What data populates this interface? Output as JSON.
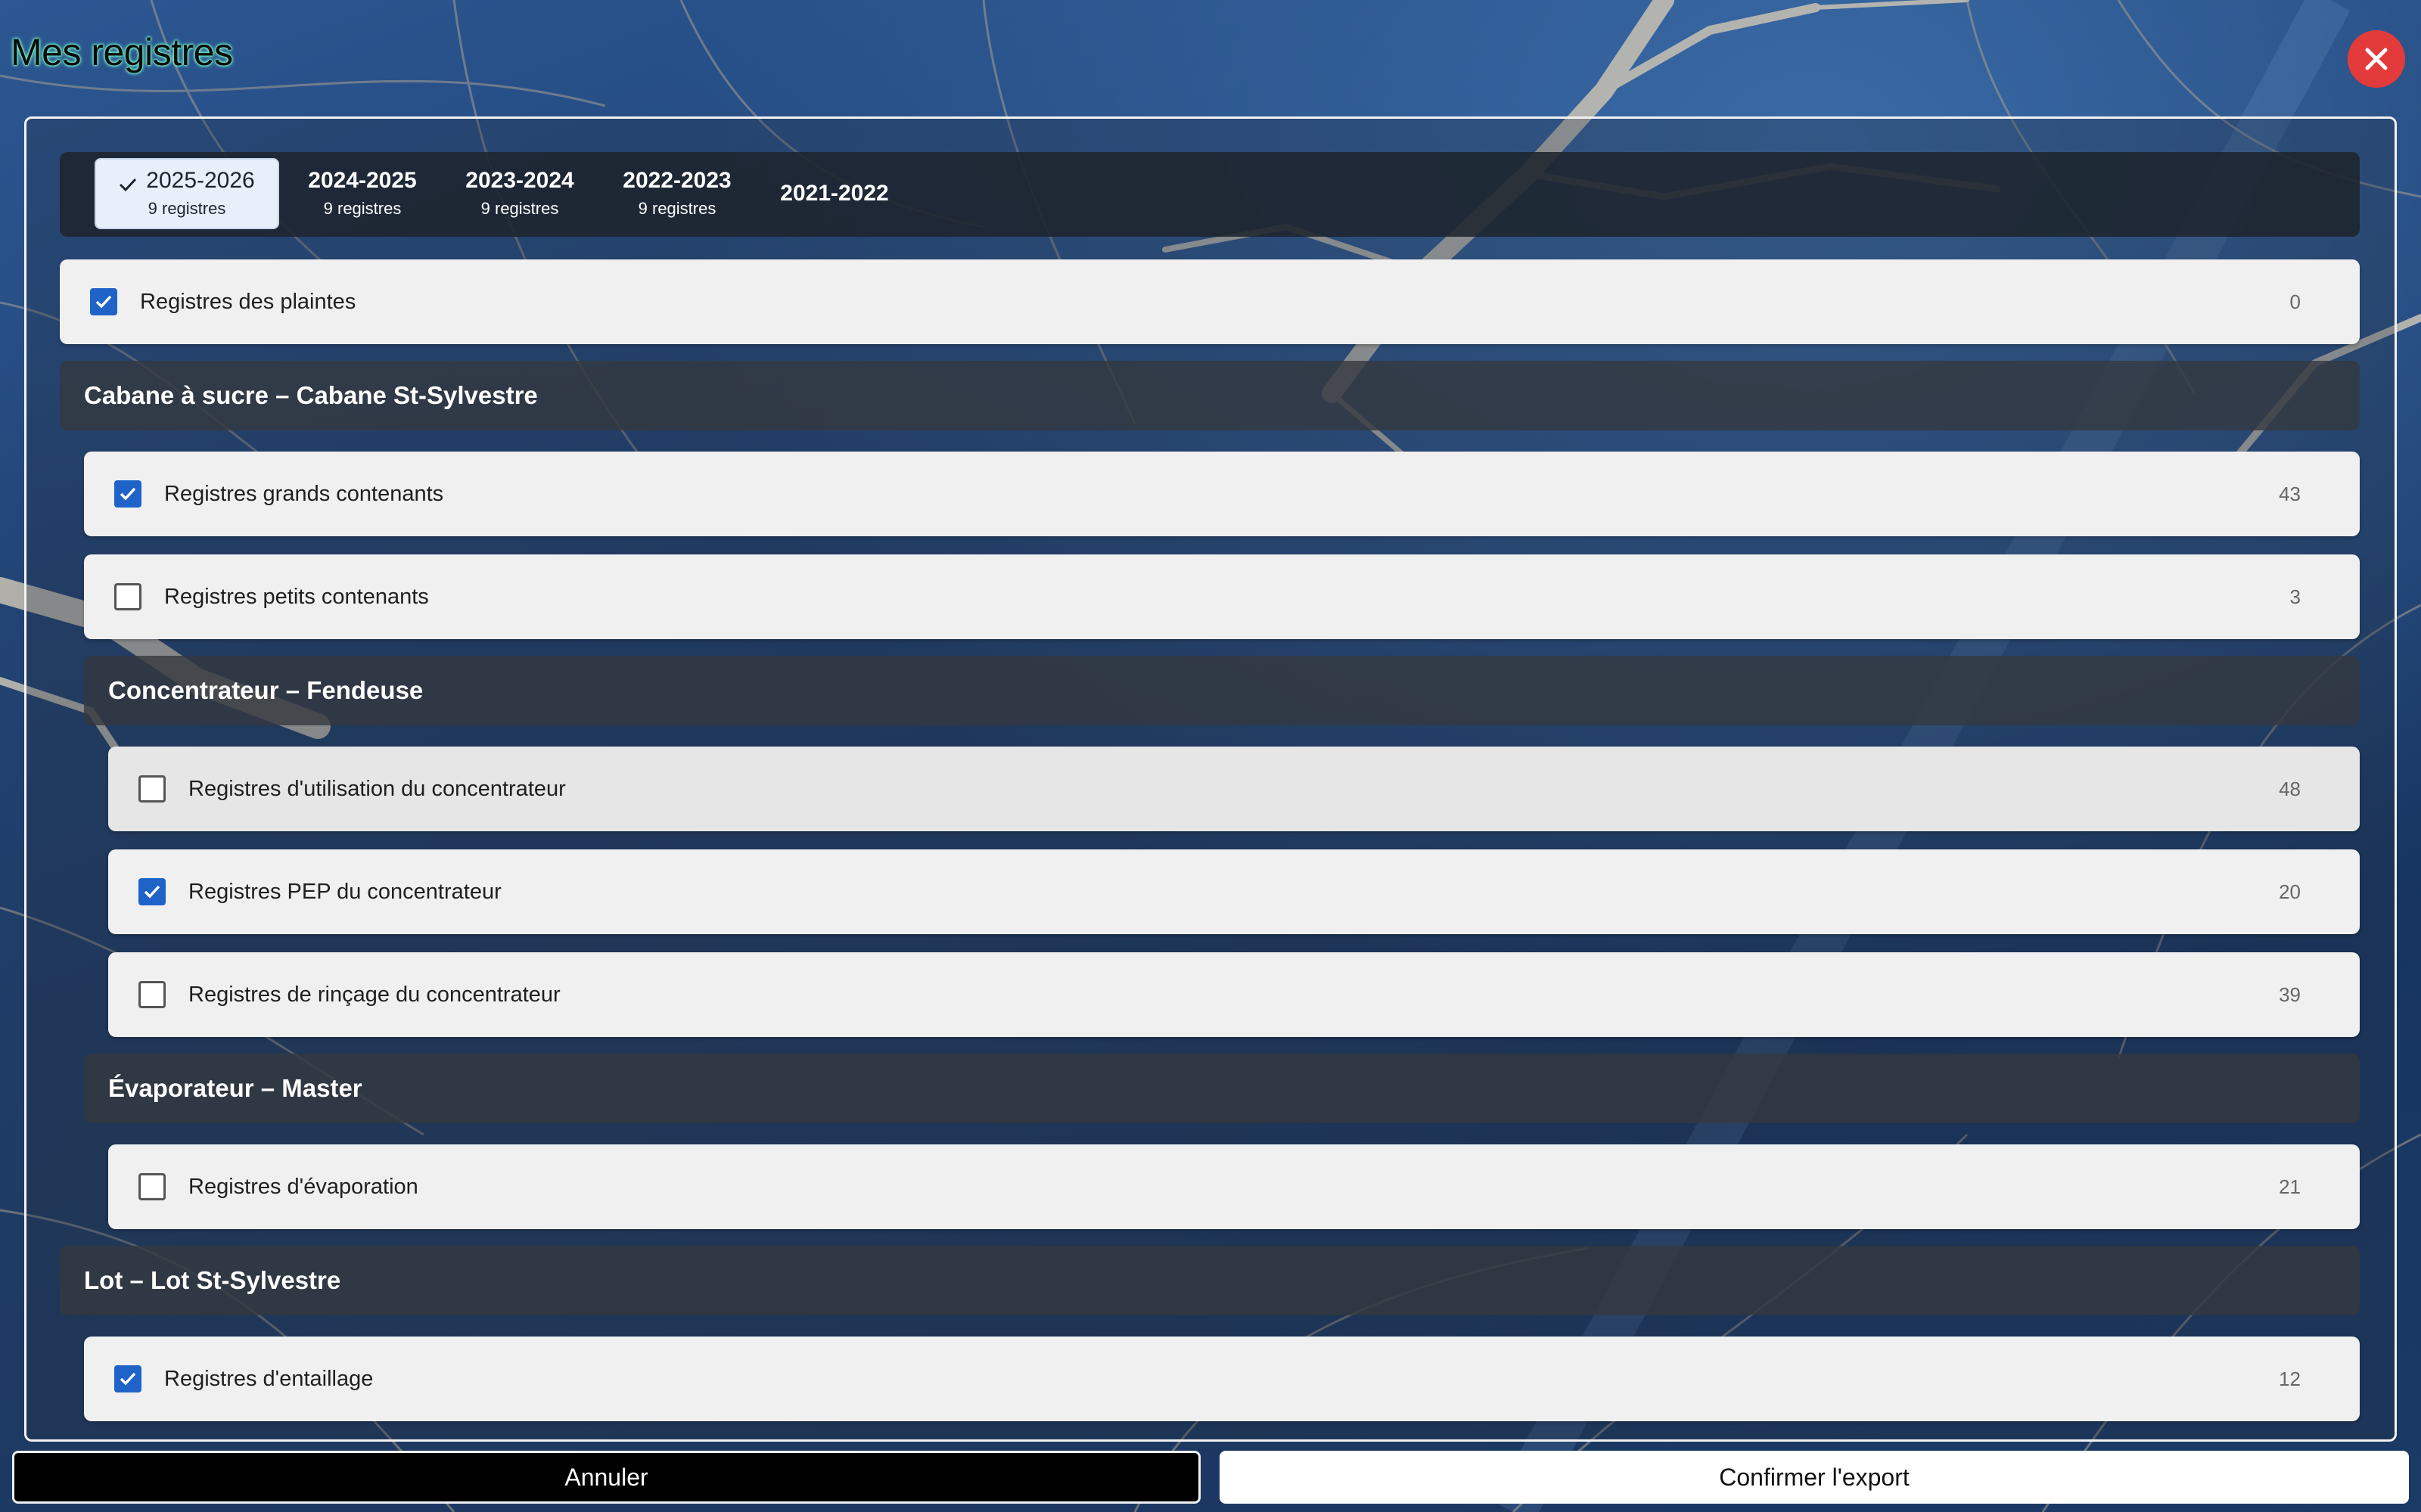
{
  "header": {
    "title": "Mes registres",
    "close_icon": "close-icon"
  },
  "tabs": [
    {
      "label": "2025-2026",
      "count": "9 registres",
      "active": true
    },
    {
      "label": "2024-2025",
      "count": "9 registres",
      "active": false
    },
    {
      "label": "2023-2024",
      "count": "9 registres",
      "active": false
    },
    {
      "label": "2022-2023",
      "count": "9 registres",
      "active": false
    },
    {
      "label": "2021-2022",
      "count": "",
      "active": false
    }
  ],
  "top_item": {
    "label": "Registres des plaintes",
    "count": "0",
    "checked": true
  },
  "groups": [
    {
      "title": "Cabane à sucre – Cabane St-Sylvestre",
      "items": [
        {
          "label": "Registres grands contenants",
          "count": "43",
          "checked": true
        },
        {
          "label": "Registres petits contenants",
          "count": "3",
          "checked": false
        }
      ]
    },
    {
      "title": "Concentrateur – Fendeuse",
      "items": [
        {
          "label": "Registres d'utilisation du concentrateur",
          "count": "48",
          "checked": false
        },
        {
          "label": "Registres PEP du concentrateur",
          "count": "20",
          "checked": true
        },
        {
          "label": "Registres de rinçage du concentrateur",
          "count": "39",
          "checked": false
        }
      ]
    },
    {
      "title": "Évaporateur – Master",
      "items": [
        {
          "label": "Registres d'évaporation",
          "count": "21",
          "checked": false
        }
      ]
    },
    {
      "title": "Lot – Lot St-Sylvestre",
      "items": [
        {
          "label": "Registres d'entaillage",
          "count": "12",
          "checked": true
        }
      ]
    }
  ],
  "footer": {
    "cancel_label": "Annuler",
    "confirm_label": "Confirmer l'export"
  },
  "colors": {
    "accent": "#1f63c9",
    "close": "#e33b3b",
    "title_glow": "#6fe8c8"
  }
}
